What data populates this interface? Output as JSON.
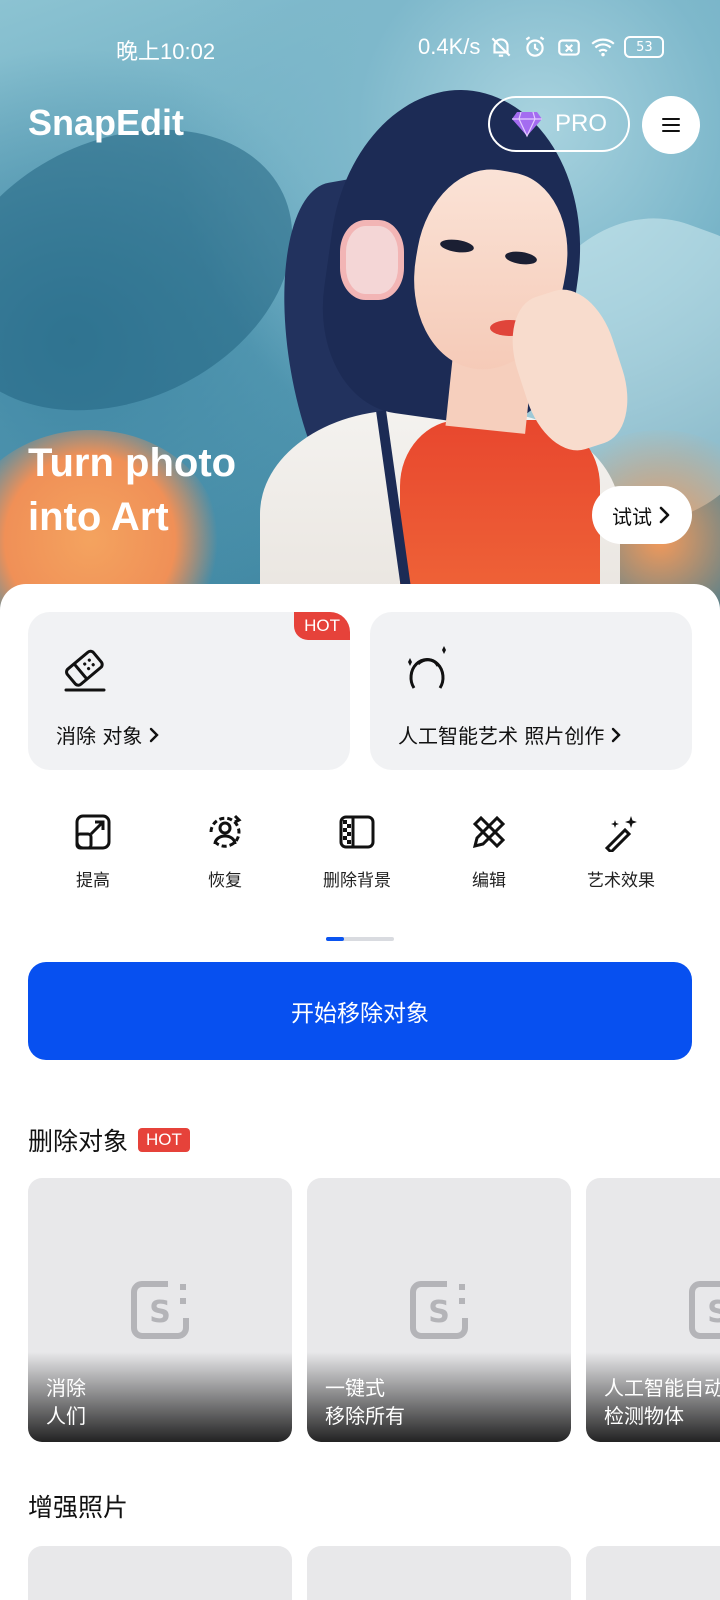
{
  "status_bar": {
    "time": "晚上10:02",
    "net_speed": "0.4K/s",
    "battery": "53"
  },
  "header": {
    "app_name": "SnapEdit",
    "pro_label": "PRO"
  },
  "hero": {
    "title_line1": "Turn photo",
    "title_line2": "into Art",
    "try_label": "试试"
  },
  "feature_cards": [
    {
      "label": "消除 对象",
      "badge": "HOT",
      "icon": "eraser-icon"
    },
    {
      "label": "人工智能艺术 照片创作",
      "icon": "ai-face-icon"
    }
  ],
  "tools": [
    {
      "label": "提高",
      "icon": "upscale-icon"
    },
    {
      "label": "恢复",
      "icon": "restore-face-icon"
    },
    {
      "label": "删除背景",
      "icon": "remove-bg-icon"
    },
    {
      "label": "编辑",
      "icon": "edit-tools-icon"
    },
    {
      "label": "艺术效果",
      "icon": "magic-wand-icon"
    }
  ],
  "cta": {
    "label": "开始移除对象"
  },
  "section_remove": {
    "title": "删除对象",
    "badge": "HOT",
    "tiles": [
      {
        "line1": "消除",
        "line2": "人们"
      },
      {
        "line1": "一键式",
        "line2": "移除所有"
      },
      {
        "line1": "人工智能自动",
        "line2": "检测物体"
      }
    ]
  },
  "section_enhance": {
    "title": "增强照片"
  },
  "colors": {
    "accent_blue": "#0750f0",
    "hot_red": "#e6423a",
    "card_bg": "#f1f2f4"
  }
}
